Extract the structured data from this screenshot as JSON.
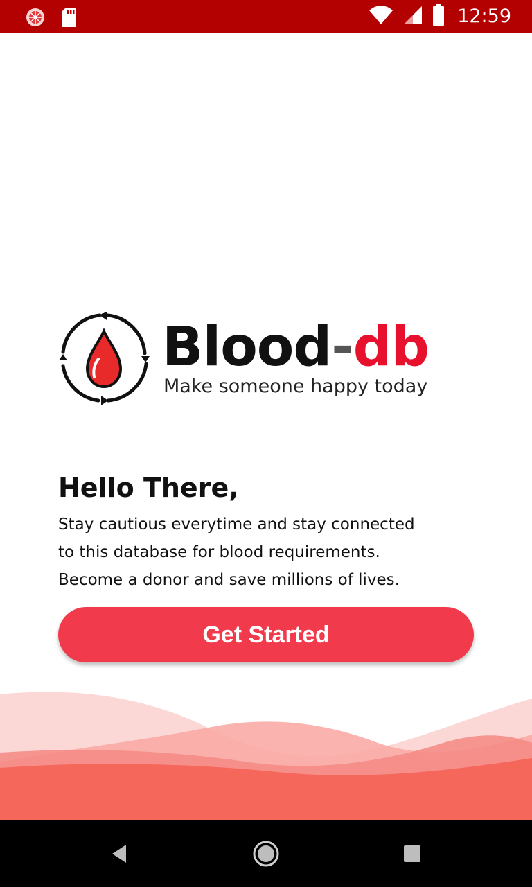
{
  "status_bar": {
    "time": "12:59",
    "background": "#b30000",
    "icons": [
      "notification-circle-icon",
      "sd-card-icon",
      "wifi-icon",
      "signal-icon",
      "battery-icon"
    ]
  },
  "logo": {
    "title_part1": "Blood",
    "title_separator": "-",
    "title_part2": "db",
    "tagline": "Make someone happy today",
    "icon": "blood-drop-cycle-icon",
    "accent_color": "#e8112d"
  },
  "greeting": {
    "title": "Hello There,",
    "lines": [
      "Stay cautious everytime and stay connected",
      "to this database for blood requirements.",
      "Become a donor and save millions of lives."
    ]
  },
  "cta": {
    "label": "Get Started",
    "color": "#f23a4d"
  },
  "nav_bar": {
    "icons": [
      "back-icon",
      "home-icon",
      "recents-icon"
    ]
  }
}
